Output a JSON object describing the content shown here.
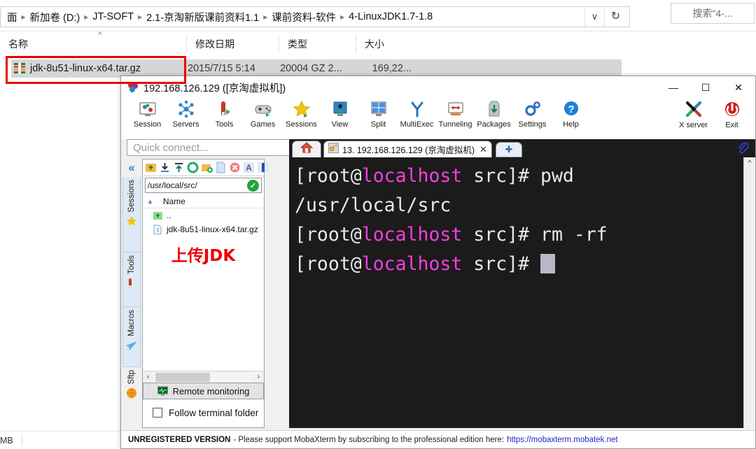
{
  "explorer": {
    "breadcrumbs": [
      "面",
      "新加卷 (D:)",
      "JT-SOFT",
      "2.1-京淘新版课前资料1.1",
      "课前资料-软件",
      "4-LinuxJDK1.7-1.8"
    ],
    "chevron_icon": "chevron-down-icon",
    "refresh_icon": "refresh-icon",
    "search_placeholder": "搜索\"4-...",
    "columns": [
      "名称",
      "修改日期",
      "类型",
      "大小"
    ],
    "sort_caret": "^",
    "rows": [
      {
        "icon": "archive-icon",
        "name": "jdk-8u51-linux-x64.tar.gz",
        "date": "2015/7/15 5:14",
        "type": "20004 GZ 2...",
        "size": "169,22..."
      }
    ],
    "status_text": "MB"
  },
  "moba": {
    "title": "192.168.126.129 ([京淘虚拟机])",
    "app_icon": "mobaxterm-icon",
    "window_buttons": [
      {
        "name": "minimize-button",
        "glyph": "—"
      },
      {
        "name": "maximize-button",
        "glyph": "☐"
      },
      {
        "name": "close-button",
        "glyph": "✕"
      }
    ],
    "toolbar": [
      {
        "icon": "session-icon",
        "label": "Session"
      },
      {
        "icon": "servers-icon",
        "label": "Servers"
      },
      {
        "icon": "tools-icon",
        "label": "Tools"
      },
      {
        "icon": "games-icon",
        "label": "Games"
      },
      {
        "icon": "sessions-star-icon",
        "label": "Sessions"
      },
      {
        "icon": "view-icon",
        "label": "View"
      },
      {
        "icon": "split-icon",
        "label": "Split"
      },
      {
        "icon": "multiexec-icon",
        "label": "MultiExec"
      },
      {
        "icon": "tunneling-icon",
        "label": "Tunneling"
      },
      {
        "icon": "packages-icon",
        "label": "Packages"
      },
      {
        "icon": "settings-gear-icon",
        "label": "Settings"
      },
      {
        "icon": "help-icon",
        "label": "Help"
      }
    ],
    "toolbar_right": [
      {
        "icon": "x-server-icon",
        "label": "X server"
      },
      {
        "icon": "exit-power-icon",
        "label": "Exit"
      }
    ],
    "quick_connect_placeholder": "Quick connect...",
    "sidebar": {
      "collapse_icon": "double-chevron-left-icon",
      "tabs": [
        {
          "label": "Sessions",
          "icon": "star-icon"
        },
        {
          "label": "Tools",
          "icon": "wrench-icon"
        },
        {
          "label": "Macros",
          "icon": "paper-plane-icon"
        },
        {
          "label": "Sftp",
          "icon": "globe-icon"
        }
      ]
    },
    "sftp": {
      "toolbar_icons": [
        "parent-folder-icon",
        "download-icon",
        "upload-icon",
        "refresh-icon",
        "new-folder-icon",
        "new-file-icon",
        "delete-icon",
        "text-mode-icon",
        "binary-mode-icon"
      ],
      "path": "/usr/local/src/",
      "path_ok_icon": "check-circle-icon",
      "column_header": "Name",
      "sort_caret_icon": "caret-up-icon",
      "files": [
        {
          "icon": "parent-folder-icon",
          "name": ".."
        },
        {
          "icon": "file-icon",
          "name": "jdk-8u51-linux-x64.tar.gz"
        }
      ],
      "annotation": "上传JDK",
      "scroll_left_icon": "chevron-left-icon",
      "scroll_right_icon": "chevron-right-icon",
      "remote_monitoring_label": "Remote monitoring",
      "remote_monitoring_icon": "monitor-graph-icon",
      "follow_terminal_label": "Follow terminal folder",
      "follow_terminal_checked": false
    },
    "tabs": {
      "home_icon": "home-icon",
      "active_icon": "ssh-key-icon",
      "active_label": "13. 192.168.126.129 (京淘虚拟机)",
      "close_icon": "close-icon",
      "new_tab_icon": "plus-icon",
      "clip_icon": "paperclip-icon"
    },
    "terminal": {
      "prompt_user_host_pre": "[root@",
      "prompt_host": "localhost",
      "prompt_post": " src]# ",
      "lines": [
        {
          "type": "prompt",
          "command": "pwd"
        },
        {
          "type": "output",
          "text": "/usr/local/src"
        },
        {
          "type": "prompt",
          "command": "rm -rf"
        },
        {
          "type": "prompt_cursor",
          "command": ""
        }
      ],
      "scroll_up_icon": "caret-up-icon",
      "fg_color": "#e8e8e8",
      "host_color": "#f53ee0",
      "bg_color": "#1b1b1b"
    },
    "status": {
      "bold": "UNREGISTERED VERSION",
      "text": "- Please support MobaXterm by subscribing to the professional edition here:",
      "link": "https://mobaxterm.mobatek.net"
    }
  },
  "colors": {
    "annotation_red": "#ee0000",
    "accent_blue": "#2f7ed8"
  }
}
